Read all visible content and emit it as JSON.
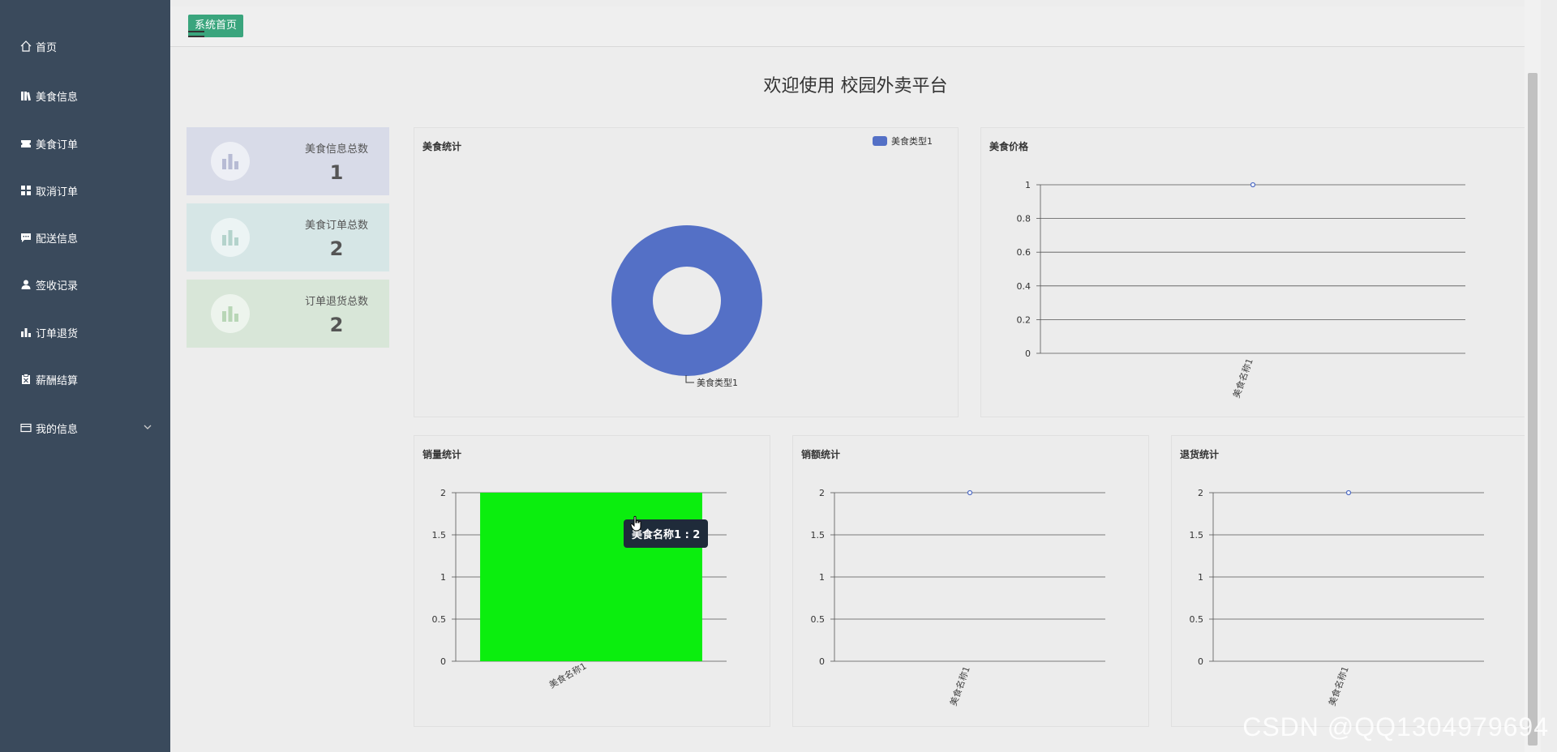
{
  "sidebar": {
    "items": [
      {
        "label": "首页",
        "icon": "home-icon"
      },
      {
        "label": "美食信息",
        "icon": "library-icon"
      },
      {
        "label": "美食订单",
        "icon": "ticket-icon"
      },
      {
        "label": "取消订单",
        "icon": "grid-icon"
      },
      {
        "label": "配送信息",
        "icon": "message-icon"
      },
      {
        "label": "签收记录",
        "icon": "user-icon"
      },
      {
        "label": "订单退货",
        "icon": "bar-chart-icon"
      },
      {
        "label": "薪酬结算",
        "icon": "clipboard-icon"
      },
      {
        "label": "我的信息",
        "icon": "card-icon"
      }
    ]
  },
  "header": {
    "tag": "系统首页"
  },
  "welcome": "欢迎使用 校园外卖平台",
  "stats": [
    {
      "label": "美食信息总数",
      "value": "1",
      "bg": "#d8dbe8"
    },
    {
      "label": "美食订单总数",
      "value": "2",
      "bg": "#d6e6e6"
    },
    {
      "label": "订单退货总数",
      "value": "2",
      "bg": "#d8e6d8"
    }
  ],
  "panels": {
    "pie_title": "美食统计",
    "price_title": "美食价格",
    "sales_title": "销量统计",
    "amount_title": "销额统计",
    "return_title": "退货统计"
  },
  "tooltip": "美食名称1 : 2",
  "watermark": "CSDN @QQ1304979694",
  "colors": {
    "sidebar": "#3a4a5c",
    "accent": "#3aa57d",
    "pie": "#5470c6",
    "bar": "#0bee0e"
  },
  "chart_data": [
    {
      "type": "pie",
      "title": "美食统计",
      "labels": [
        "美食类型1"
      ],
      "values": [
        1
      ],
      "legend": [
        "美食类型1"
      ],
      "legend_position": "top-right",
      "donut": true
    },
    {
      "type": "line",
      "title": "美食价格",
      "categories": [
        "美食名称1"
      ],
      "values": [
        1
      ],
      "ylim": [
        0,
        1
      ],
      "yticks": [
        "0",
        "0.2",
        "0.4",
        "0.6",
        "0.8",
        "1"
      ],
      "grid": true
    },
    {
      "type": "bar",
      "title": "销量统计",
      "categories": [
        "美食名称1"
      ],
      "values": [
        2
      ],
      "ylim": [
        0,
        2
      ],
      "yticks": [
        "0",
        "0.5",
        "1",
        "1.5",
        "2"
      ],
      "grid": true
    },
    {
      "type": "line",
      "title": "销额统计",
      "categories": [
        "美食名称1"
      ],
      "values": [
        2
      ],
      "ylim": [
        0,
        2
      ],
      "yticks": [
        "0",
        "0.5",
        "1",
        "1.5",
        "2"
      ],
      "grid": true
    },
    {
      "type": "line",
      "title": "退货统计",
      "categories": [
        "美食名称1"
      ],
      "values": [
        2
      ],
      "ylim": [
        0,
        2
      ],
      "yticks": [
        "0",
        "0.5",
        "1",
        "1.5",
        "2"
      ],
      "grid": true
    }
  ]
}
